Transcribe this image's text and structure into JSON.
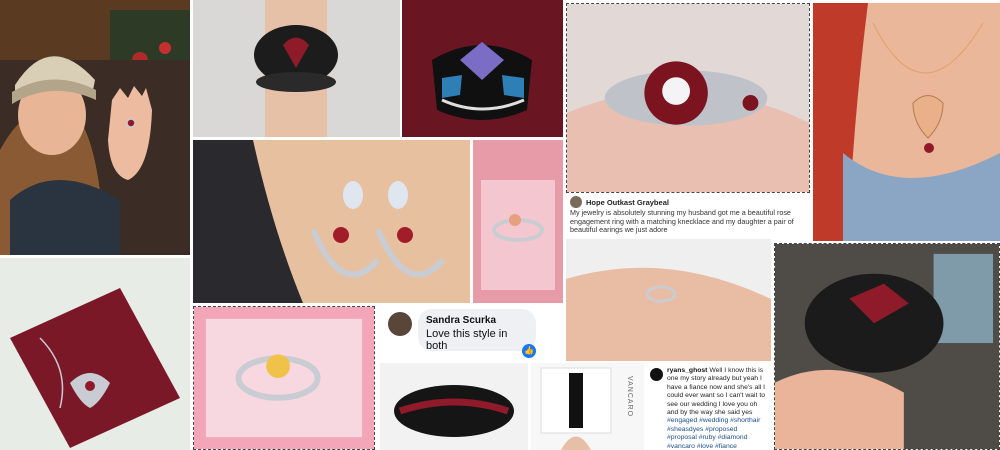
{
  "reviews": {
    "hope": {
      "name": "Hope Outkast Graybeal",
      "text": "My jewelry is absolutely stunning my husband got me a beautiful rose engagement ring with a matching knecklace and my daughter a pair of beautiful earings we just adore"
    },
    "sandra": {
      "name": "Sandra Scurka",
      "text": "Love this style in both"
    },
    "ryans": {
      "name": "ryans_ghost",
      "text": "Well I know this is one my story already but yeah I have a fiance now and she's all I could ever want so I can't wait to see our wedding I love you oh and by the way she said yes",
      "hashtags": "#engaged #wedding #shorthair #sheasdyes #proposed #proposal #ruby #diamond #vancaro #love #fiance"
    }
  },
  "product_box_text": "VANCARO",
  "colors": {
    "ruby": "#8e1a2a",
    "silver": "#c9ccd2",
    "black": "#1a1a1a",
    "blush": "#f3b8c4"
  }
}
